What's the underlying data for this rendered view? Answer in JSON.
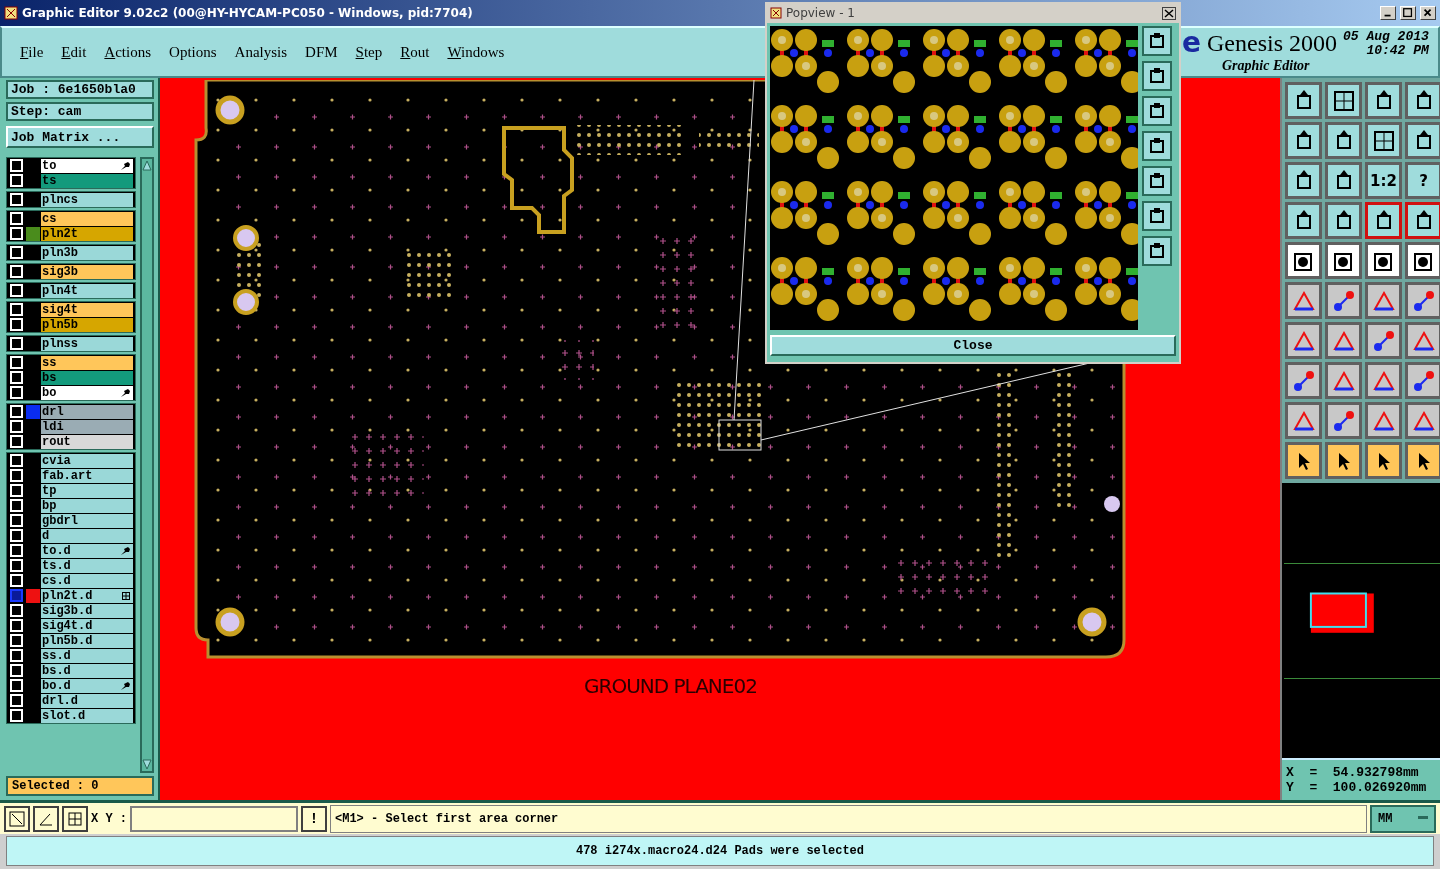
{
  "window": {
    "title": "Graphic Editor 9.02c2 (00@HY-HYCAM-PC050 - Windows, pid:7704)"
  },
  "menu": [
    {
      "label": "File",
      "mnemonic": true
    },
    {
      "label": "Edit",
      "mnemonic": true
    },
    {
      "label": "Actions",
      "mnemonic": true
    },
    {
      "label": "Options",
      "mnemonic": false
    },
    {
      "label": "Analysis",
      "mnemonic": false
    },
    {
      "label": "DFM",
      "mnemonic": false
    },
    {
      "label": "Step",
      "mnemonic": true
    },
    {
      "label": "Rout",
      "mnemonic": true
    },
    {
      "label": "Windows",
      "mnemonic": true
    }
  ],
  "header": {
    "logo_fragment": "e",
    "product": "Genesis 2000",
    "subtitle": "Graphic Editor",
    "date": "05 Aug 2013",
    "time": "10:42 PM"
  },
  "job": {
    "job": "Job : 6e1650bla0",
    "step": "Step: cam",
    "matrix_button": "Job Matrix ..."
  },
  "layer_groups": [
    {
      "layers": [
        {
          "name": "to",
          "color": "#ffffff",
          "kind": "pointer",
          "selected": false
        },
        {
          "name": "ts",
          "color": "#139a7c",
          "kind": "plain",
          "selected": false
        }
      ]
    },
    {
      "layers": [
        {
          "name": "plncs",
          "color": "#9ad8d8",
          "selected": false
        }
      ]
    },
    {
      "layers": [
        {
          "name": "cs",
          "color": "#ffc65a",
          "selected": false
        },
        {
          "name": "pln2t",
          "color": "#d6a600",
          "swatch": {
            "color": "#4a8c1c"
          },
          "selected": false
        }
      ]
    },
    {
      "layers": [
        {
          "name": "pln3b",
          "color": "#9ad8d8",
          "selected": false
        }
      ]
    },
    {
      "layers": [
        {
          "name": "sig3b",
          "color": "#ffc65a",
          "selected": false
        }
      ]
    },
    {
      "layers": [
        {
          "name": "pln4t",
          "color": "#9ad8d8",
          "selected": false
        }
      ]
    },
    {
      "layers": [
        {
          "name": "sig4t",
          "color": "#ffc65a",
          "selected": false
        },
        {
          "name": "pln5b",
          "color": "#d6a600",
          "selected": false
        }
      ]
    },
    {
      "layers": [
        {
          "name": "plnss",
          "color": "#9ad8d8",
          "selected": false
        }
      ]
    },
    {
      "layers": [
        {
          "name": "ss",
          "color": "#ffc65a",
          "kind": "plain",
          "selected": false
        },
        {
          "name": "bs",
          "color": "#139a7c",
          "kind": "plain",
          "selected": false
        },
        {
          "name": "bo",
          "color": "#ffffff",
          "kind": "pointer",
          "selected": false
        }
      ]
    },
    {
      "layers": [
        {
          "name": "drl",
          "color": "#9aacb4",
          "swatch": {
            "color": "#0a2cf0"
          },
          "selected": false
        },
        {
          "name": "ldi",
          "color": "#9aacb4",
          "selected": false
        },
        {
          "name": "rout",
          "color": "#d8d8d8",
          "selected": false
        }
      ]
    },
    {
      "layers": [
        {
          "name": "cvia",
          "color": "#9ad8d8",
          "selected": false
        },
        {
          "name": "fab.art",
          "color": "#9ad8d8",
          "selected": false
        },
        {
          "name": "tp",
          "color": "#9ad8d8",
          "selected": false
        },
        {
          "name": "bp",
          "color": "#9ad8d8",
          "selected": false
        },
        {
          "name": "gbdrl",
          "color": "#9ad8d8",
          "selected": false
        },
        {
          "name": "d",
          "color": "#9ad8d8",
          "selected": false
        },
        {
          "name": "to.d",
          "color": "#9ad8d8",
          "kind": "pointer",
          "selected": false
        },
        {
          "name": "ts.d",
          "color": "#9ad8d8",
          "selected": false
        },
        {
          "name": "cs.d",
          "color": "#9ad8d8",
          "selected": false
        },
        {
          "name": "pln2t.d",
          "color": "#9ad8d8",
          "swatch": {
            "color": "#ee1111"
          },
          "kind": "grid",
          "selected": true
        },
        {
          "name": "sig3b.d",
          "color": "#9ad8d8",
          "selected": false
        },
        {
          "name": "sig4t.d",
          "color": "#9ad8d8",
          "selected": false
        },
        {
          "name": "pln5b.d",
          "color": "#9ad8d8",
          "selected": false
        },
        {
          "name": "ss.d",
          "color": "#9ad8d8",
          "selected": false
        },
        {
          "name": "bs.d",
          "color": "#9ad8d8",
          "selected": false
        },
        {
          "name": "bo.d",
          "color": "#9ad8d8",
          "kind": "pointer",
          "selected": false
        },
        {
          "name": "drl.d",
          "color": "#9ad8d8",
          "selected": false
        },
        {
          "name": "slot.d",
          "color": "#9ad8d8",
          "selected": false
        }
      ]
    }
  ],
  "selected_count": "Selected : 0",
  "canvas": {
    "label": "GROUND PLANE02"
  },
  "popview": {
    "title": "Popview - 1",
    "close": "Close"
  },
  "tools": [
    {
      "kind": "view",
      "highlighted": false
    },
    {
      "kind": "view",
      "highlighted": false
    },
    {
      "kind": "view",
      "highlighted": false
    },
    {
      "kind": "view",
      "highlighted": false
    },
    {
      "kind": "view",
      "highlighted": false
    },
    {
      "kind": "view",
      "highlighted": false
    },
    {
      "kind": "view",
      "highlighted": false
    },
    {
      "kind": "view",
      "highlighted": false
    },
    {
      "kind": "view",
      "highlighted": false
    },
    {
      "kind": "view",
      "highlighted": false
    },
    {
      "kind": "view",
      "highlighted": false,
      "label": "1:2"
    },
    {
      "kind": "view",
      "highlighted": false,
      "label": "?"
    },
    {
      "kind": "view",
      "highlighted": false
    },
    {
      "kind": "view",
      "highlighted": false
    },
    {
      "kind": "view",
      "highlighted": true
    },
    {
      "kind": "view",
      "highlighted": true
    },
    {
      "kind": "display",
      "highlighted": false
    },
    {
      "kind": "display",
      "highlighted": false
    },
    {
      "kind": "display",
      "highlighted": false
    },
    {
      "kind": "display",
      "highlighted": false
    },
    {
      "kind": "edit",
      "highlighted": false
    },
    {
      "kind": "edit",
      "highlighted": false
    },
    {
      "kind": "edit",
      "highlighted": false
    },
    {
      "kind": "edit",
      "highlighted": false
    },
    {
      "kind": "edit",
      "highlighted": false
    },
    {
      "kind": "edit",
      "highlighted": false
    },
    {
      "kind": "edit",
      "highlighted": false
    },
    {
      "kind": "edit",
      "highlighted": false
    },
    {
      "kind": "edit",
      "highlighted": false
    },
    {
      "kind": "edit",
      "highlighted": false
    },
    {
      "kind": "edit",
      "highlighted": false
    },
    {
      "kind": "edit",
      "highlighted": false
    },
    {
      "kind": "edit",
      "highlighted": false
    },
    {
      "kind": "edit",
      "highlighted": false
    },
    {
      "kind": "edit",
      "highlighted": false
    },
    {
      "kind": "edit",
      "highlighted": false
    },
    {
      "kind": "select",
      "highlighted": false
    },
    {
      "kind": "select",
      "highlighted": false
    },
    {
      "kind": "select",
      "highlighted": false
    },
    {
      "kind": "select",
      "highlighted": false
    }
  ],
  "coordinates": {
    "x": "X  =  54.932798mm",
    "y": "Y  =  100.026920mm"
  },
  "command_bar": {
    "xy_label": "X Y :",
    "exclaim": "!",
    "prompt": "<M1> - Select first area corner",
    "units": "MM"
  },
  "status": "478 i274x.macro24.d24 Pads were selected"
}
